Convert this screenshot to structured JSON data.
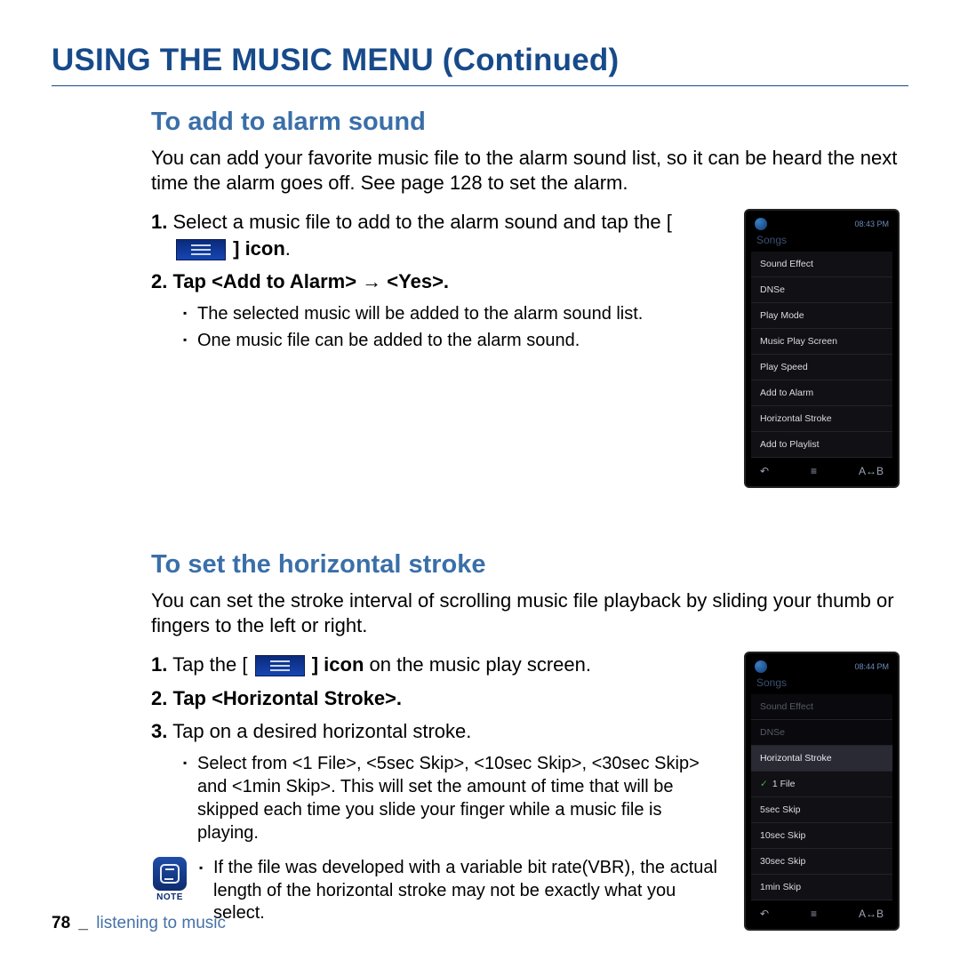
{
  "header": {
    "title": "USING THE MUSIC MENU (Continued)"
  },
  "section1": {
    "title": "To add to alarm sound",
    "intro": "You can add your favorite music file to the alarm sound list, so it can be heard the next time the alarm goes off. See page 128 to set the alarm.",
    "step1_num": "1.",
    "step1_a": "Select a music file to add to the alarm sound and tap the [",
    "step1_b": "] icon",
    "step1_bold_last": ".",
    "step2_num": "2.",
    "step2_text": "Tap <Add to Alarm> → <Yes>.",
    "sub1": "The selected music will be added to the alarm sound list.",
    "sub2": "One music file can be added to the alarm sound."
  },
  "section2": {
    "title": "To set the horizontal stroke",
    "intro": "You can set the stroke interval of scrolling music file playback by sliding your thumb or fingers to the left or right.",
    "step1_num": "1.",
    "step1_a": "Tap the [",
    "step1_b": "] icon",
    "step1_tail": " on the music play screen.",
    "step2_num": "2.",
    "step2_text": "Tap <Horizontal Stroke>.",
    "step3_num": "3.",
    "step3_text": "Tap on a desired horizontal stroke.",
    "sub1": "Select from <1 File>, <5sec Skip>, <10sec Skip>, <30sec Skip> and <1min Skip>. This will set the amount of time that will be skipped each time you slide your finger while a music file is playing.",
    "note_label": "NOTE",
    "note_text": "If the file was developed with a variable bit rate(VBR), the actual length of the horizontal stroke may not be exactly what you select."
  },
  "phone1": {
    "status_time": "08:43 PM",
    "header_text": "Songs",
    "items": [
      "Sound Effect",
      "DNSe",
      "Play Mode",
      "Music Play Screen",
      "Play Speed",
      "Add to Alarm",
      "Horizontal Stroke",
      "Add to Playlist"
    ],
    "bottom_right": "A↔B"
  },
  "phone2": {
    "status_time": "08:44 PM",
    "header_text": "Songs",
    "dim_items": [
      "Sound Effect",
      "DNSe"
    ],
    "panel_head": "Horizontal Stroke",
    "panel_items": [
      {
        "label": "1 File",
        "checked": true
      },
      {
        "label": "5sec Skip",
        "checked": false
      },
      {
        "label": "10sec Skip",
        "checked": false
      },
      {
        "label": "30sec Skip",
        "checked": false
      },
      {
        "label": "1min Skip",
        "checked": false
      }
    ],
    "bottom_right": "A↔B"
  },
  "footer": {
    "page_number": "78",
    "separator": "_",
    "chapter": "listening to music"
  }
}
